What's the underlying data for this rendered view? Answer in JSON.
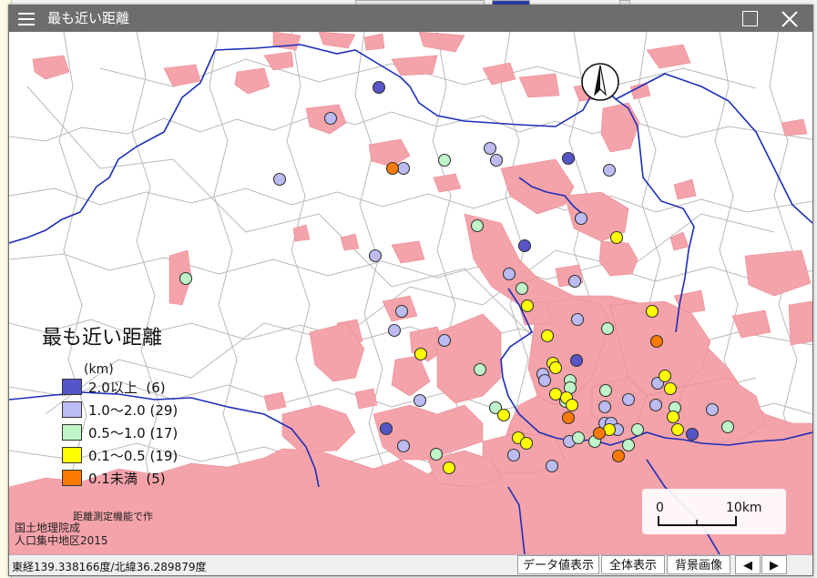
{
  "window": {
    "title": "最も近い距離"
  },
  "legend": {
    "title": "最も近い距離",
    "unit": "(km)",
    "items": [
      {
        "label": "2.0以上  (6)",
        "color": "#5555c8"
      },
      {
        "label": "1.0～2.0 (29)",
        "color": "#bcbcf2"
      },
      {
        "label": "0.5～1.0 (17)",
        "color": "#bff5c8"
      },
      {
        "label": "0.1～0.5 (19)",
        "color": "#ffff00"
      },
      {
        "label": "0.1未満  (5)",
        "color": "#ff7a00"
      }
    ]
  },
  "credits": {
    "tool": "距離測定機能で作",
    "line1": "国土地理院成",
    "line2": "人口集中地区2015"
  },
  "scalebar": {
    "left_label": "0",
    "right_label": "10km"
  },
  "status": {
    "coordinates": "東経139.338166度/北緯36.289879度",
    "btn_data": "データ値表示",
    "btn_full": "全体表示",
    "btn_bg": "背景画像",
    "btn_prev": "◀",
    "btn_next": "▶"
  },
  "colors": {
    "did_area": "#f5a3aa",
    "boundary_major": "#1c2db8",
    "boundary_minor": "#b8b8b8"
  }
}
